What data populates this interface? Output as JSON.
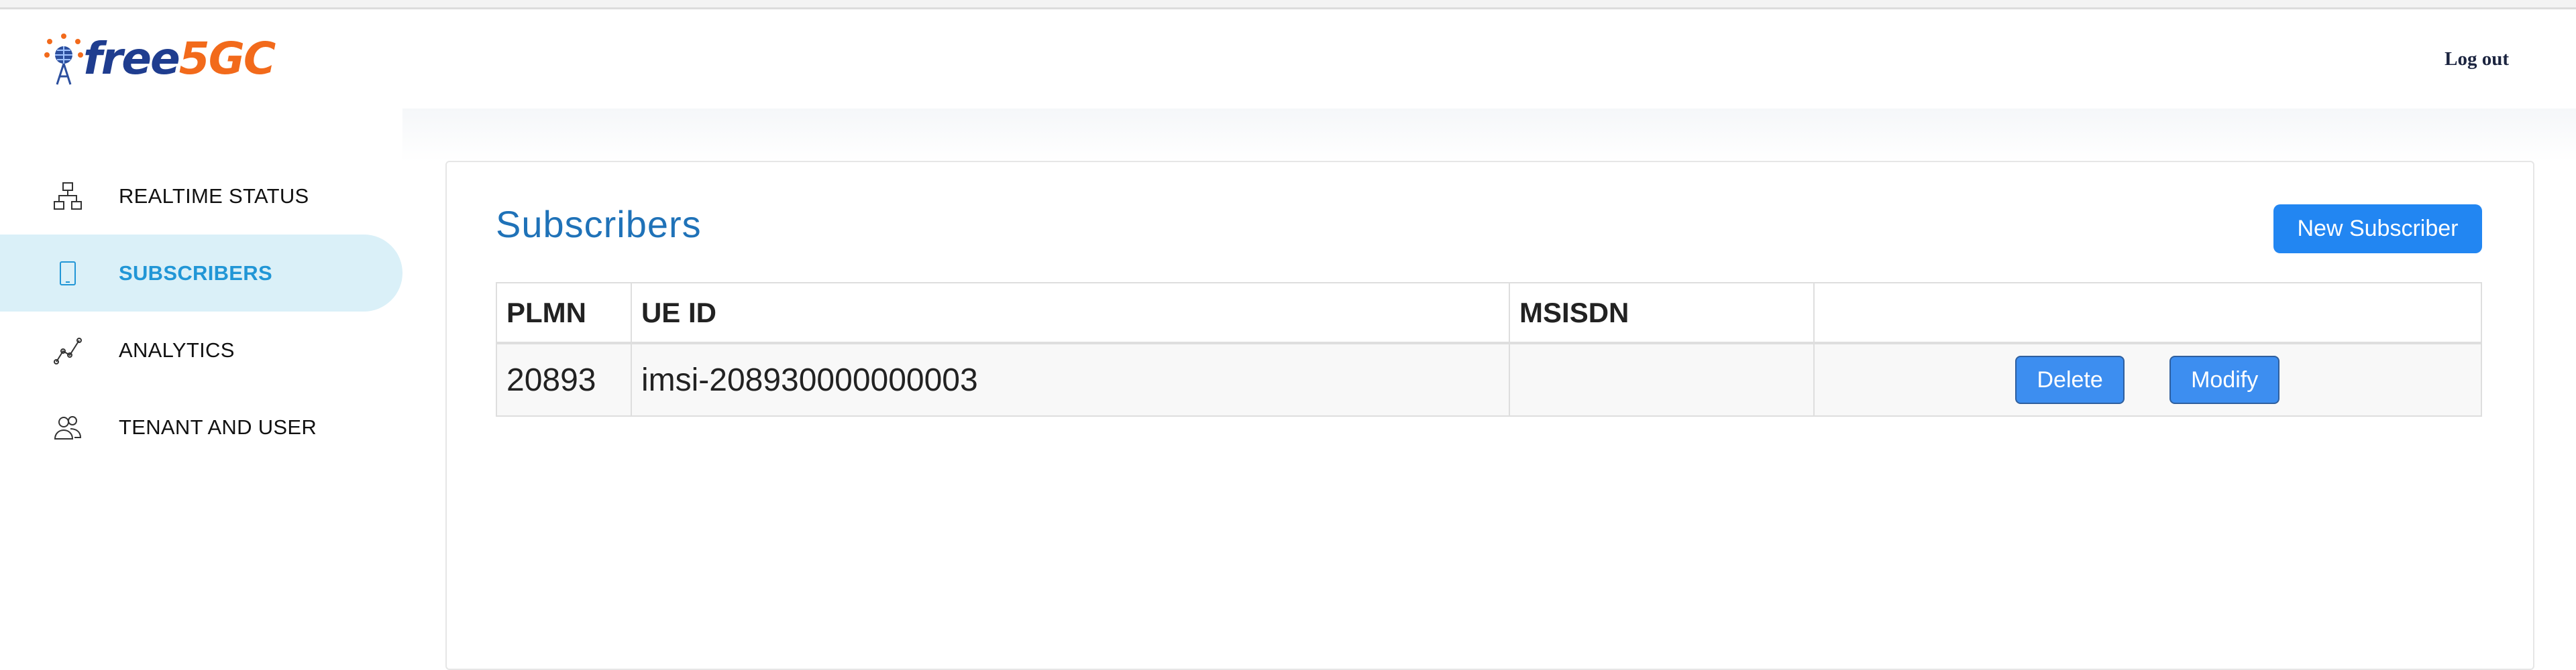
{
  "brand": {
    "logo_part1": "free",
    "logo_part2": "5GC"
  },
  "header": {
    "logout_label": "Log out"
  },
  "sidebar": {
    "items": [
      {
        "label": "REALTIME STATUS",
        "icon": "sitemap-icon",
        "active": false
      },
      {
        "label": "SUBSCRIBERS",
        "icon": "tablet-icon",
        "active": true
      },
      {
        "label": "ANALYTICS",
        "icon": "line-chart-icon",
        "active": false
      },
      {
        "label": "TENANT AND USER",
        "icon": "users-icon",
        "active": false
      }
    ]
  },
  "main": {
    "title": "Subscribers",
    "new_button_label": "New Subscriber",
    "table": {
      "columns": [
        "PLMN",
        "UE ID",
        "MSISDN",
        ""
      ],
      "rows": [
        {
          "plmn": "20893",
          "ue_id": "imsi-208930000000003",
          "msisdn": "",
          "delete_label": "Delete",
          "modify_label": "Modify"
        }
      ]
    }
  },
  "colors": {
    "accent": "#2286f2",
    "title": "#1f72b8",
    "active_nav_bg": "#daf0f8",
    "active_nav_text": "#2196d6",
    "logo_blue": "#1f3d8f",
    "logo_orange": "#f26a1b"
  }
}
